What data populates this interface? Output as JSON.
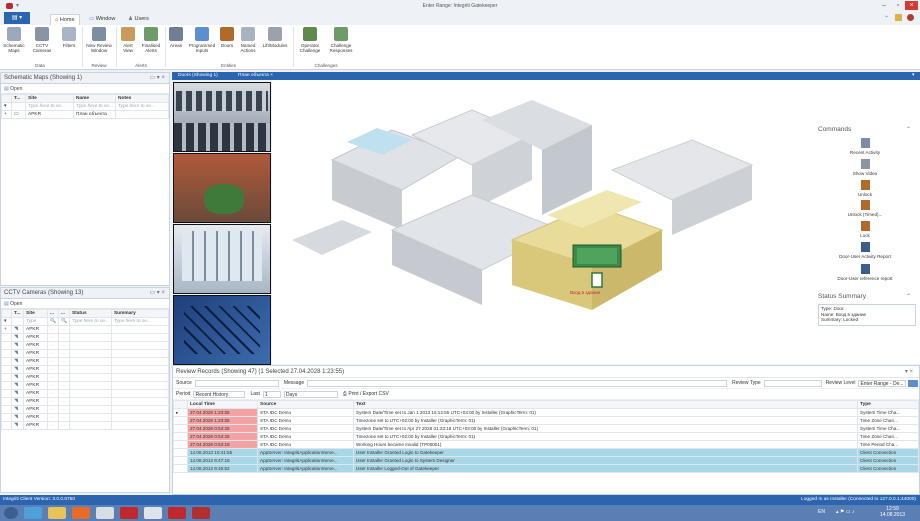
{
  "app": {
    "title": "Enter Range: Integriti Gatekeeper"
  },
  "ribbon": {
    "tabs": [
      "Home",
      "Window",
      "Users"
    ],
    "buttons": [
      {
        "label": "Schematic Maps",
        "icon": "map-icon"
      },
      {
        "label": "CCTV Cameras",
        "icon": "camera-icon"
      },
      {
        "label": "Filters",
        "icon": "filter-icon"
      },
      {
        "label": "New Review Window",
        "icon": "review-icon"
      },
      {
        "label": "Alert View",
        "icon": "alert-icon"
      },
      {
        "label": "Finalised Alerts",
        "icon": "alert-finalised-icon"
      },
      {
        "label": "Areas",
        "icon": "areas-icon"
      },
      {
        "label": "Programmed Inputs",
        "icon": "input-icon"
      },
      {
        "label": "Doors",
        "icon": "door-icon"
      },
      {
        "label": "Named Actions",
        "icon": "action-icon"
      },
      {
        "label": "Lift/Modules",
        "icon": "lift-icon"
      },
      {
        "label": "Operator Challenge",
        "icon": "operator-icon"
      },
      {
        "label": "Challenge Responses",
        "icon": "response-icon"
      }
    ],
    "groups": [
      "Data",
      "Review",
      "Alerts",
      "Entities",
      "Challenges"
    ]
  },
  "schematic": {
    "title": "Schematic Maps (Showing 1)",
    "open": "Open",
    "columns": [
      "T...",
      "Site",
      "Name",
      "Notes"
    ],
    "filter": "Type here to se...",
    "rows": [
      {
        "site": "APKR",
        "name": "План объекта"
      }
    ]
  },
  "cctv": {
    "title": "CCTV Cameras (Showing 13)",
    "open": "Open",
    "columns": [
      "T...",
      "Site",
      "...",
      "...",
      "Status",
      "Summary"
    ],
    "filter_short": "Type",
    "filter": "Type here to se...",
    "rows": [
      "APKR",
      "APKR",
      "APKR",
      "APKR",
      "APKR",
      "APKR",
      "APKR",
      "APKR",
      "APKR",
      "APKR",
      "APKR",
      "APKR",
      "APKR"
    ]
  },
  "doctabs": [
    "Doors (Showing 1)",
    "План объекта"
  ],
  "map": {
    "door_label": "Вход в здание"
  },
  "commands": {
    "title": "Commands",
    "items": [
      {
        "label": "Recent Activity",
        "icon": "recent-activity-icon",
        "color": "#7a8ea6"
      },
      {
        "label": "Show Video",
        "icon": "video-icon",
        "color": "#8a96a6"
      },
      {
        "label": "Unlock",
        "icon": "door-unlock-icon",
        "color": "#b06a2a"
      },
      {
        "label": "Unlock (Timed)...",
        "icon": "door-timed-icon",
        "color": "#b06a2a"
      },
      {
        "label": "Lock",
        "icon": "door-lock-icon",
        "color": "#b06a2a"
      },
      {
        "label": "Door-User Activity Report",
        "icon": "user-report-icon",
        "color": "#3a5f8a"
      },
      {
        "label": "Door-User reference report",
        "icon": "user-reference-icon",
        "color": "#3a5f8a"
      }
    ]
  },
  "status_summary": {
    "title": "Status Summary",
    "type": "Type: Door",
    "name": "Name: Вход в здание",
    "summary": "Summary: Locked"
  },
  "review": {
    "title": "Review Records (Showing 47) (1 Selected 27.04.2028 1:23:55)",
    "source_label": "Source",
    "message_label": "Message",
    "review_type_label": "Review Type",
    "review_level_label": "Review Level",
    "review_level_value": "Enter Range - De...",
    "period_label": "Period",
    "period_value": "Recent History",
    "last_label": "Last",
    "last_value": "1",
    "unit_value": "Days",
    "print_label": "Print / Export CSV",
    "columns": [
      "Local Time",
      "Source",
      "Text",
      "Type"
    ],
    "rows": [
      {
        "time": "27.04.2028 1:23:55",
        "source": "STA IDC Demo",
        "text": "System Date/Time set to Jan 1 2013 16:12:55 UTC+03:00 by Installer (GraphicTerm: 01)",
        "type": "System Time Cha...",
        "kind": "red"
      },
      {
        "time": "27.04.2028 1:23:55",
        "source": "STA IDC Demo",
        "text": "Timezone set to UTC+02:00 by Installer (GraphicTerm: 01)",
        "type": "Time Zone Chan...",
        "kind": "red"
      },
      {
        "time": "27.04.2028 0:54:26",
        "source": "STA IDC Demo",
        "text": "System Date/Time set to Apr 27 2028 01:23:19 UTC+03:00 by Installer (GraphicTerm: 01)",
        "type": "System Time Cha...",
        "kind": "red"
      },
      {
        "time": "27.04.2028 0:54:26",
        "source": "STA IDC Demo",
        "text": "Timezone set to UTC+02:00 by Installer (GraphicTerm: 01)",
        "type": "Time Zone Chan...",
        "kind": "red"
      },
      {
        "time": "27.04.2028 0:53:19",
        "source": "STA IDC Demo",
        "text": "Working Hours became Invalid (TP00001)",
        "type": "Time Period Cha...",
        "kind": "red"
      },
      {
        "time": "14.08.2013 10:41:55",
        "source": "AppServer: IntegritiApplicationServe...",
        "text": "User Installer Granted Login to Gatekeeper",
        "type": "Client Connection",
        "kind": "blue"
      },
      {
        "time": "14.08.2013 9:47:16",
        "source": "AppServer: IntegritiApplicationServe...",
        "text": "User Installer Granted Login to System Designer",
        "type": "Client Connection",
        "kind": "blue"
      },
      {
        "time": "14.08.2013 9:46:52",
        "source": "AppServer: IntegritiApplicationServe...",
        "text": "User Installer Logged-Out of Gatekeeper",
        "type": "Client Connection",
        "kind": "blue"
      }
    ]
  },
  "statusbar": {
    "left": "Integriti Client Version: 3.0.0.6750",
    "right": "Logged In as Installer (Connected to 127.0.0.1:44000)"
  },
  "tray": {
    "lang": "EN",
    "time": "12:59",
    "date": "14.08.2013"
  },
  "colors": {
    "accent": "#2b65b0",
    "red_row": "#f3a3a3",
    "blue_row": "#a8d8e8"
  }
}
